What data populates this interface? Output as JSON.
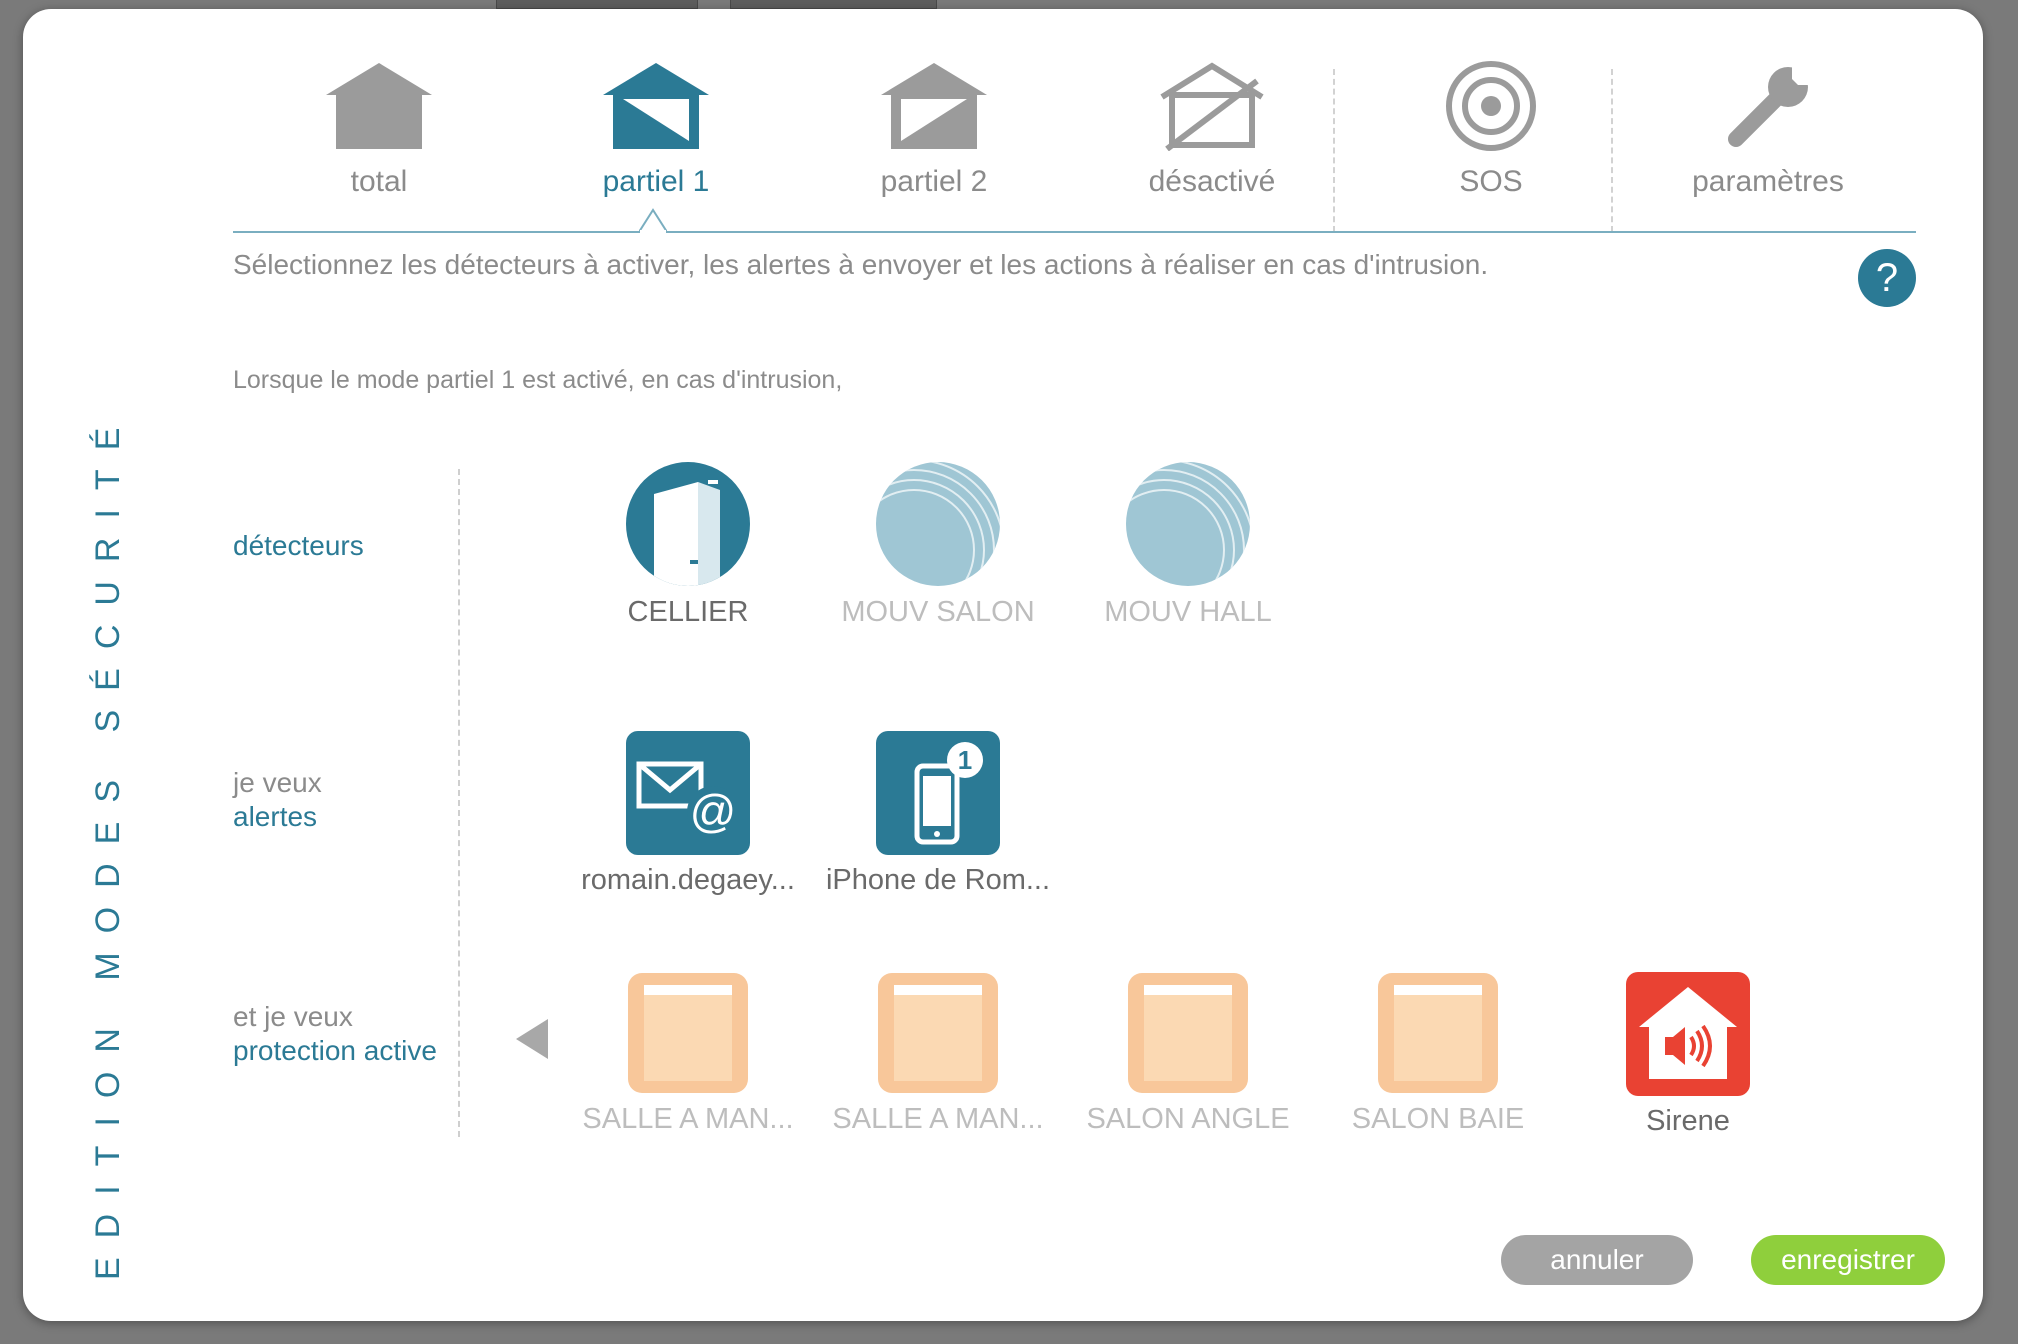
{
  "side_title": "EDITION MODES SÉCURITÉ",
  "tabs": [
    {
      "label": "total",
      "icon": "house-full-icon",
      "active": false
    },
    {
      "label": "partiel 1",
      "icon": "house-partial1-icon",
      "active": true
    },
    {
      "label": "partiel 2",
      "icon": "house-partial2-icon",
      "active": false
    },
    {
      "label": "désactivé",
      "icon": "house-off-icon",
      "active": false
    },
    {
      "label": "SOS",
      "icon": "target-icon",
      "active": false
    },
    {
      "label": "paramètres",
      "icon": "wrench-icon",
      "active": false
    }
  ],
  "intro": "Sélectionnez les détecteurs à activer, les alertes à envoyer et les actions à réaliser en cas d'intrusion.",
  "help_label": "?",
  "lead": "Lorsque le mode partiel 1 est activé, en cas d'intrusion,",
  "sections": {
    "detectors": {
      "prefix": "",
      "title": "détecteurs"
    },
    "alerts": {
      "prefix": "je veux",
      "title": "alertes"
    },
    "protection": {
      "prefix": "et je veux",
      "title": "protection active"
    }
  },
  "detectors": [
    {
      "label": "CELLIER",
      "icon": "door-sensor-icon",
      "enabled": true
    },
    {
      "label": "MOUV SALON",
      "icon": "motion-sensor-icon",
      "enabled": false
    },
    {
      "label": "MOUV HALL",
      "icon": "motion-sensor-icon",
      "enabled": false
    }
  ],
  "alerts": [
    {
      "label": "romain.degaey...",
      "icon": "email-icon",
      "enabled": true
    },
    {
      "label": "iPhone de Rom...",
      "icon": "phone-notification-icon",
      "badge": "1",
      "enabled": true
    }
  ],
  "protection": [
    {
      "label": "SALLE A MAN...",
      "icon": "shutter-icon",
      "enabled": false
    },
    {
      "label": "SALLE A MAN...",
      "icon": "shutter-icon",
      "enabled": false
    },
    {
      "label": "SALON ANGLE",
      "icon": "shutter-icon",
      "enabled": false
    },
    {
      "label": "SALON BAIE",
      "icon": "shutter-icon",
      "enabled": false
    },
    {
      "label": "Sirene",
      "icon": "siren-icon",
      "enabled": true
    }
  ],
  "buttons": {
    "cancel": "annuler",
    "save": "enregistrer"
  },
  "colors": {
    "accent": "#2b7a95",
    "save": "#8fcf3c",
    "cancel": "#a4a4a4",
    "siren": "#e94233",
    "shutter": "#f8c79a",
    "disabled_sensor": "#9fc6d4"
  }
}
